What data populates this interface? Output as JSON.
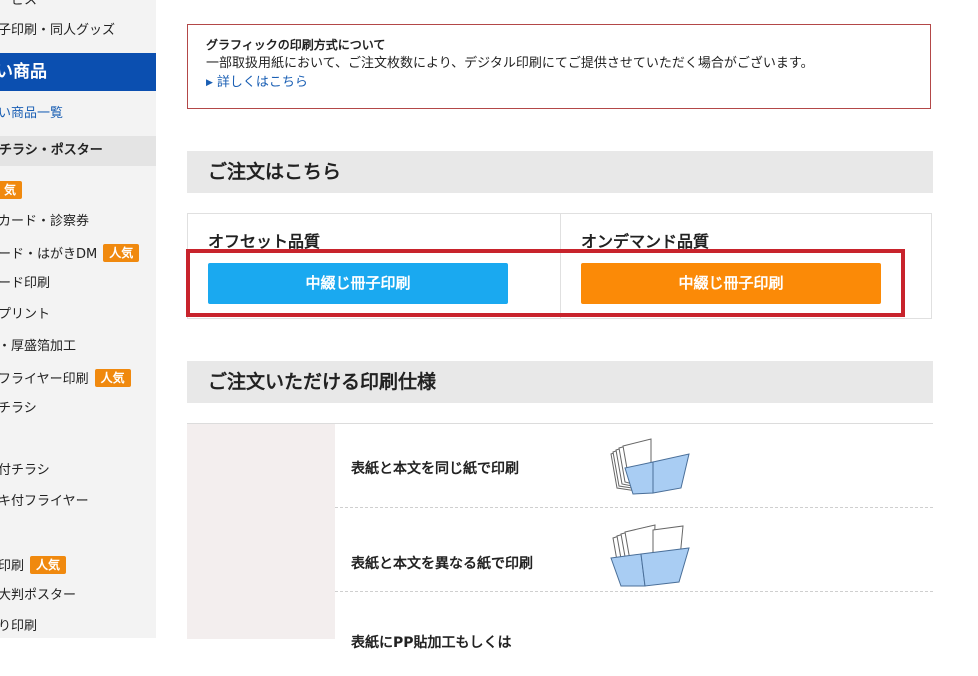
{
  "sidebar": {
    "top_items": [
      "ービス",
      "子印刷・同人グッズ"
    ],
    "category": "い商品",
    "category_link": "い商品一覧",
    "subcategory": "チラシ・ポスター",
    "badge_label": "人気",
    "solo_badge": "気",
    "items": [
      {
        "label": "カード・診察券",
        "badge": ""
      },
      {
        "label": "ード・はがきDM",
        "badge": "人気"
      },
      {
        "label": "ード印刷",
        "badge": ""
      },
      {
        "label": "プリント",
        "badge": ""
      },
      {
        "label": "・厚盛箔加工",
        "badge": ""
      },
      {
        "label": "フライヤー印刷",
        "badge": "人気"
      },
      {
        "label": "チラシ",
        "badge": ""
      },
      {
        "label": "付チラシ",
        "badge": ""
      },
      {
        "label": "キ付フライヤー",
        "badge": ""
      },
      {
        "label": "印刷",
        "badge": "人気"
      },
      {
        "label": "大判ポスター",
        "badge": ""
      },
      {
        "label": "り印刷",
        "badge": ""
      }
    ]
  },
  "notice": {
    "title": "グラフィックの印刷方式について",
    "body": "一部取扱用紙において、ご注文枚数により、デジタル印刷にてご提供させていただく場合がございます。",
    "link": "詳しくはこちら"
  },
  "order_section": {
    "heading": "ご注文はこちら",
    "columns": [
      {
        "label": "オフセット品質",
        "button": "中綴じ冊子印刷"
      },
      {
        "label": "オンデマンド品質",
        "button": "中綴じ冊子印刷"
      }
    ]
  },
  "spec_section": {
    "heading": "ご注文いただける印刷仕様",
    "rows": [
      {
        "label": "表紙と本文を同じ紙で印刷",
        "icon": "booklet-same-paper-icon"
      },
      {
        "label": "表紙と本文を異なる紙で印刷",
        "icon": "booklet-different-paper-icon"
      },
      {
        "label": "表紙にPP貼加工もしくは",
        "icon": ""
      }
    ]
  },
  "colors": {
    "sidebar_category_bg": "#0b4fb0",
    "badge": "#f0890e",
    "offset_button": "#1aa9f0",
    "ondemand_button": "#fb8a07",
    "highlight": "#c8232c",
    "notice_border": "#b34848",
    "link": "#1a5fb4"
  }
}
